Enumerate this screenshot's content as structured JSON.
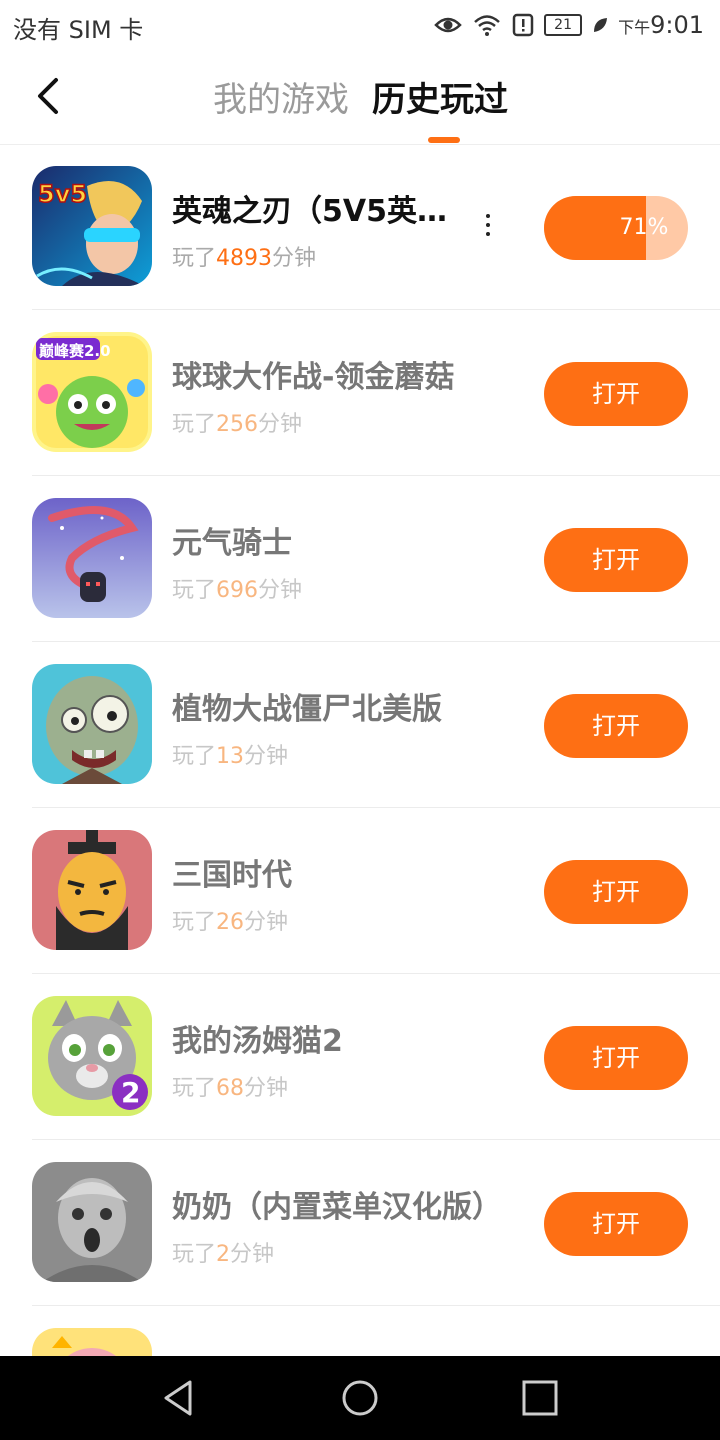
{
  "status_bar": {
    "carrier": "没有 SIM 卡",
    "battery": "21",
    "time_prefix": "下午",
    "time": "9:01"
  },
  "header": {
    "tab_mine": "我的游戏",
    "tab_history": "历史玩过"
  },
  "played_prefix": "玩了",
  "played_suffix": "分钟",
  "open_label": "打开",
  "games": [
    {
      "title": "英魂之刃（5V5英…",
      "minutes": "4893",
      "progress": "71%",
      "progress_value": 0.71,
      "icon": "hero-game-icon",
      "badge": "5v5"
    },
    {
      "title": "球球大作战-领金蘑菇",
      "minutes": "256",
      "icon": "ball-battle-icon",
      "badge": "巅峰赛2.0"
    },
    {
      "title": "元气骑士",
      "minutes": "696",
      "icon": "soul-knight-icon"
    },
    {
      "title": "植物大战僵尸北美版",
      "minutes": "13",
      "icon": "zombie-icon"
    },
    {
      "title": "三国时代",
      "minutes": "26",
      "icon": "three-kingdoms-icon"
    },
    {
      "title": "我的汤姆猫2",
      "minutes": "68",
      "icon": "tom-cat-icon",
      "badge": "2"
    },
    {
      "title": "奶奶（内置菜单汉化版）",
      "minutes": "2",
      "icon": "granny-icon"
    },
    {
      "title": "",
      "minutes": "",
      "icon": "partial-game-icon"
    }
  ],
  "colors": {
    "accent": "#fe6f14",
    "accent_light": "#ffc9a6"
  }
}
